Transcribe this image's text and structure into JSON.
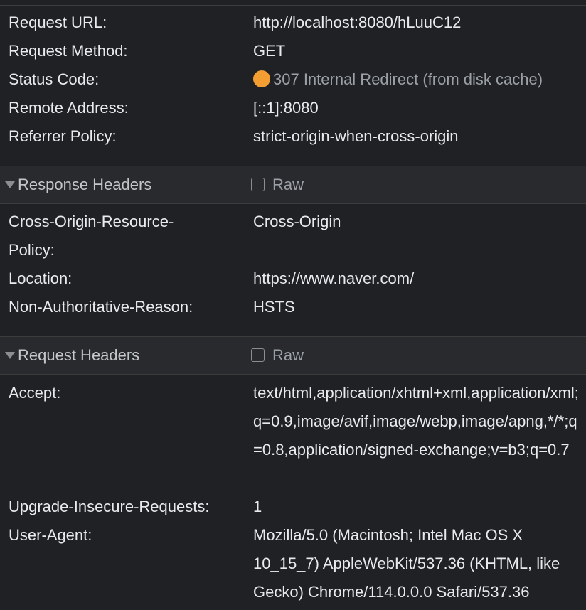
{
  "general": {
    "rows": [
      {
        "key": "Request URL:",
        "value": "http://localhost:8080/hLuuC12"
      },
      {
        "key": "Request Method:",
        "value": "GET"
      },
      {
        "key": "Status Code:",
        "value": "307 Internal Redirect (from disk cache)"
      },
      {
        "key": "Remote Address:",
        "value": "[::1]:8080"
      },
      {
        "key": "Referrer Policy:",
        "value": "strict-origin-when-cross-origin"
      }
    ],
    "status_color": "#f29e33"
  },
  "response_headers": {
    "title": "Response Headers",
    "raw_label": "Raw",
    "raw_checked": false,
    "rows": [
      {
        "key": "Cross-Origin-Resource-Policy:",
        "value": "Cross-Origin"
      },
      {
        "key": "Location:",
        "value": "https://www.naver.com/"
      },
      {
        "key": "Non-Authoritative-Reason:",
        "value": "HSTS"
      }
    ]
  },
  "request_headers": {
    "title": "Request Headers",
    "raw_label": "Raw",
    "raw_checked": false,
    "rows": [
      {
        "key": "Accept:",
        "value": "text/html,application/xhtml+xml,application/xml;q=0.9,image/avif,image/webp,image/apng,*/*;q=0.8,application/signed-exchange;v=b3;q=0.7"
      },
      {
        "key": "Upgrade-Insecure-Requests:",
        "value": "1"
      },
      {
        "key": "User-Agent:",
        "value": "Mozilla/5.0 (Macintosh; Intel Mac OS X 10_15_7) AppleWebKit/537.36 (KHTML, like Gecko) Chrome/114.0.0.0 Safari/537.36"
      }
    ]
  },
  "icons": {
    "section_toggle": "triangle-down-icon",
    "raw_checkbox": "checkbox-icon",
    "status": "status-dot-icon"
  }
}
